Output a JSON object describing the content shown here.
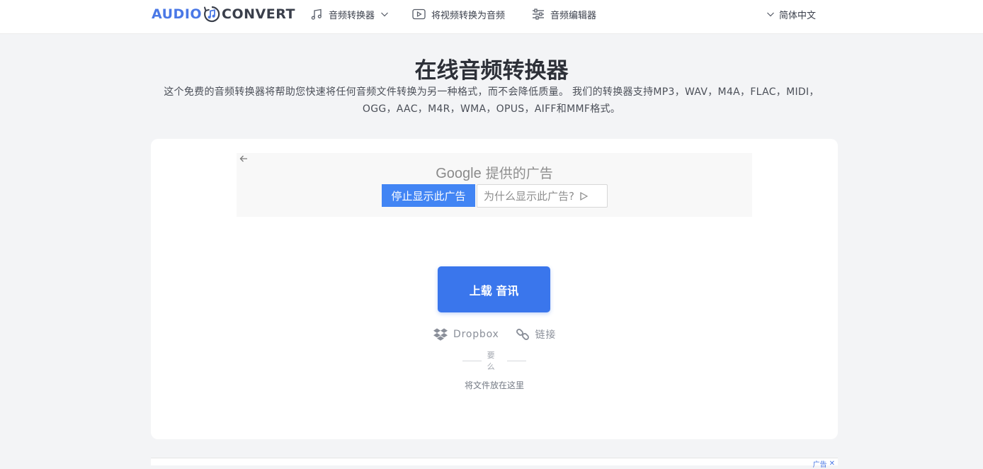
{
  "header": {
    "logo_left": "AUDIO",
    "logo_right": "CONVERT",
    "nav": [
      {
        "label": "音频转换器",
        "icon": "music-note-icon",
        "has_dropdown": true
      },
      {
        "label": "将视频转换为音频",
        "icon": "play-box-icon"
      },
      {
        "label": "音频编辑器",
        "icon": "sliders-icon"
      }
    ],
    "language": "简体中文"
  },
  "main": {
    "title": "在线音频转换器",
    "subtitle": "这个免费的音频转换器将帮助您快速将任何音频文件转换为另一种格式，而不会降低质量。 我们的转换器支持MP3，WAV，M4A，FLAC，MIDI，OGG，AAC，M4R，WMA，OPUS，AIFF和MMF格式。"
  },
  "ad": {
    "google": "Google",
    "provided_by": "提供的广告",
    "stop_label": "停止显示此广告",
    "why_label": "为什么显示此广告?"
  },
  "upload": {
    "button_label": "上载 音讯",
    "dropbox_label": "Dropbox",
    "link_label": "链接",
    "or_label": "要么",
    "drop_text": "将文件放在这里"
  },
  "bottom_ad": {
    "label": "广告"
  },
  "colors": {
    "accent": "#3a76ec",
    "logo_blue": "#4a78e6",
    "ad_blue": "#4285f4",
    "page_bg": "#f3f4f6"
  }
}
